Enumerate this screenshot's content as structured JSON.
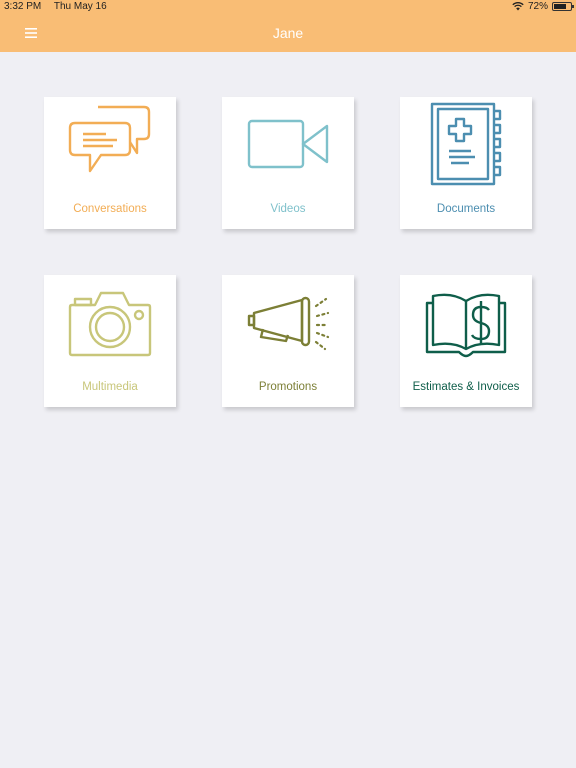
{
  "status_bar": {
    "time": "3:32 PM",
    "date": "Thu May 16",
    "battery_text": "72%",
    "battery_level": 0.72
  },
  "header": {
    "title": "Jane",
    "menu_icon": "hamburger-menu-icon"
  },
  "colors": {
    "header_bg": "#f9bd75",
    "background": "#efeff4"
  },
  "tiles": [
    {
      "label": "Conversations",
      "icon": "chat-bubbles-icon",
      "color": "#f2ad55"
    },
    {
      "label": "Videos",
      "icon": "video-camera-icon",
      "color": "#7fc1cb"
    },
    {
      "label": "Documents",
      "icon": "medical-document-icon",
      "color": "#4c8eb0"
    },
    {
      "label": "Multimedia",
      "icon": "camera-icon",
      "color": "#c8c67a"
    },
    {
      "label": "Promotions",
      "icon": "megaphone-icon",
      "color": "#7c7f36"
    },
    {
      "label": "Estimates & Invoices",
      "icon": "dollar-book-icon",
      "color": "#0f5e4a"
    }
  ]
}
